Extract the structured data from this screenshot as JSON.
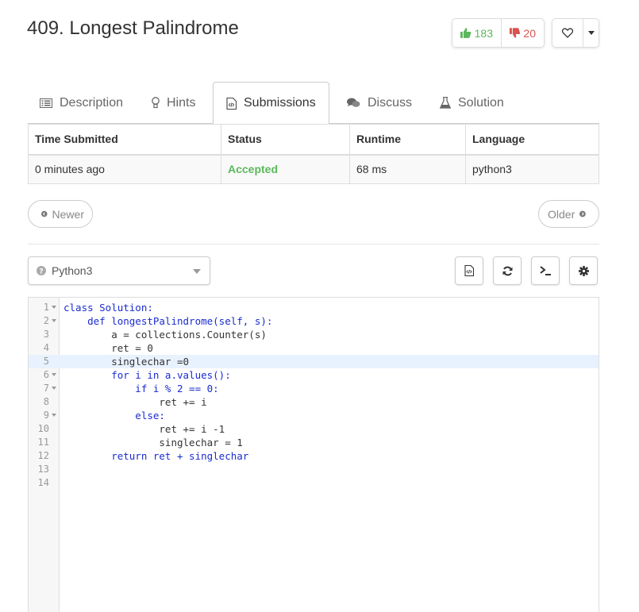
{
  "problem": {
    "title": "409. Longest Palindrome"
  },
  "votes": {
    "up": "183",
    "down": "20"
  },
  "tabs": [
    {
      "label": "Description",
      "icon": "list-icon"
    },
    {
      "label": "Hints",
      "icon": "lightbulb-icon"
    },
    {
      "label": "Submissions",
      "icon": "code-file-icon",
      "active": true
    },
    {
      "label": "Discuss",
      "icon": "comments-icon"
    },
    {
      "label": "Solution",
      "icon": "flask-icon"
    }
  ],
  "table": {
    "headers": [
      "Time Submitted",
      "Status",
      "Runtime",
      "Language"
    ],
    "rows": [
      [
        "0 minutes ago",
        "Accepted",
        "68 ms",
        "python3"
      ]
    ]
  },
  "pager": {
    "newer": "Newer",
    "older": "Older"
  },
  "editor": {
    "language": "Python3",
    "lines": [
      "class Solution:",
      "    def longestPalindrome(self, s):",
      "        a = collections.Counter(s)",
      "        ret = 0",
      "        singlechar =0",
      "        for i in a.values():",
      "            if i % 2 == 0:",
      "                ret += i",
      "            else:",
      "                ret += i -1",
      "                singlechar = 1",
      "        return ret + singlechar",
      "",
      ""
    ],
    "line_numbers": [
      "1",
      "2",
      "3",
      "4",
      "5",
      "6",
      "7",
      "8",
      "9",
      "10",
      "11",
      "12",
      "13",
      "14"
    ]
  },
  "colors": {
    "accepted": "#5cb85c",
    "downvote": "#d9534f",
    "keyword": "#1a2bd1"
  }
}
